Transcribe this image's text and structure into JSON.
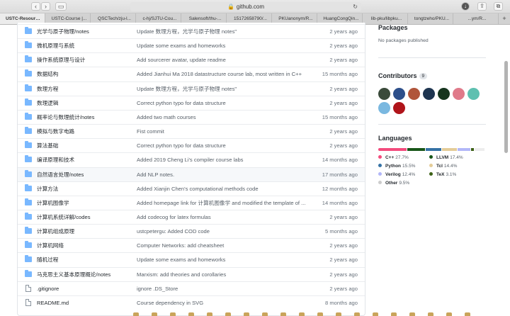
{
  "browser": {
    "url": "github.com",
    "tabs": [
      "USTC-Resourc...",
      "USTC-Course |...",
      "QSCTech/zju-l...",
      "c-hj/SJTU-Cou...",
      "Salensoft/thu-...",
      "15172658790/...",
      "PKUanonym/R...",
      "HuangCongQin...",
      "lib-pku/libpku...",
      "tongtzeho/PKU...",
      "...ym/R..."
    ]
  },
  "files": [
    {
      "type": "dir",
      "name": "光学与原子物理/notes",
      "message": "Update 数理方程，光学与原子物理 notes\"",
      "age": "2 years ago"
    },
    {
      "type": "dir",
      "name": "微机原理与系统",
      "message": "Update some exams and homeworks",
      "age": "2 years ago"
    },
    {
      "type": "dir",
      "name": "操作系统原理与设计",
      "message": "Add sourcerer avatar, update readme",
      "age": "2 years ago"
    },
    {
      "type": "dir",
      "name": "数据结构",
      "message": "Added Jianhui Ma 2018 datastructure course lab, most written in C++",
      "age": "15 months ago"
    },
    {
      "type": "dir",
      "name": "数理方程",
      "message": "Update 数理方程，光学与原子物理 notes\"",
      "age": "2 years ago"
    },
    {
      "type": "dir",
      "name": "数理逻辑",
      "message": "Correct python typo for data structure",
      "age": "2 years ago"
    },
    {
      "type": "dir",
      "name": "概率论与数理统计/notes",
      "message": "Added two math courses",
      "age": "15 months ago"
    },
    {
      "type": "dir",
      "name": "模拟与数字电路",
      "message": "Fist commit",
      "age": "2 years ago"
    },
    {
      "type": "dir",
      "name": "算法基础",
      "message": "Correct python typo for data structure",
      "age": "2 years ago"
    },
    {
      "type": "dir",
      "name": "编译原理和技术",
      "message": "Added 2019 Cheng Li's compiler course labs",
      "age": "14 months ago"
    },
    {
      "type": "dir",
      "name": "自然语言处理/notes",
      "message": "Add NLP notes.",
      "age": "17 months ago"
    },
    {
      "type": "dir",
      "name": "计算方法",
      "message": "Added Xianjin Chen's computational methods code",
      "age": "12 months ago"
    },
    {
      "type": "dir",
      "name": "计算机图像学",
      "message": "Added homepage link for 计算机图像学 and modified the template of ...",
      "age": "14 months ago"
    },
    {
      "type": "dir",
      "name": "计算机系统详解/codes",
      "message": "Add codecog for latex formulas",
      "age": "2 years ago"
    },
    {
      "type": "dir",
      "name": "计算机组成原理",
      "message": "ustcpetergu: Added COD code",
      "age": "5 months ago"
    },
    {
      "type": "dir",
      "name": "计算机网络",
      "message": "Computer Networks: add cheatsheet",
      "age": "2 years ago"
    },
    {
      "type": "dir",
      "name": "随机过程",
      "message": "Update some exams and homeworks",
      "age": "2 years ago"
    },
    {
      "type": "dir",
      "name": "马克思主义基本原理概论/notes",
      "message": "Marxism: add theories and corollaries",
      "age": "2 years ago"
    },
    {
      "type": "file",
      "name": ".gitignore",
      "message": "ignore .DS_Store",
      "age": "2 years ago"
    },
    {
      "type": "file",
      "name": "README.md",
      "message": "Course dependency in SVG",
      "age": "8 months ago"
    }
  ],
  "sidebar": {
    "packages_title": "Packages",
    "packages_text": "No packages published",
    "contributors_title": "Contributors",
    "contributors_count": "9",
    "avatar_colors": [
      "#3a4a3a",
      "#2c4f8a",
      "#b0553a",
      "#1e3550",
      "#16351e",
      "#e07a8a",
      "#5ec0b0",
      "#7ab8e0",
      "#b0141a"
    ],
    "languages_title": "Languages",
    "languages": [
      {
        "name": "C++",
        "percent": "27.7%",
        "color": "#f34b7d",
        "share": 27.7
      },
      {
        "name": "LLVM",
        "percent": "17.4%",
        "color": "#185619",
        "share": 17.4
      },
      {
        "name": "Python",
        "percent": "15.5%",
        "color": "#3572a5",
        "share": 15.5
      },
      {
        "name": "Tcl",
        "percent": "14.4%",
        "color": "#e4cc98",
        "share": 14.4
      },
      {
        "name": "Verilog",
        "percent": "12.4%",
        "color": "#b2b7f8",
        "share": 12.4
      },
      {
        "name": "TeX",
        "percent": "3.1%",
        "color": "#3d6117",
        "share": 3.1
      },
      {
        "name": "Other",
        "percent": "9.5%",
        "color": "#ededed",
        "share": 9.5
      }
    ]
  }
}
